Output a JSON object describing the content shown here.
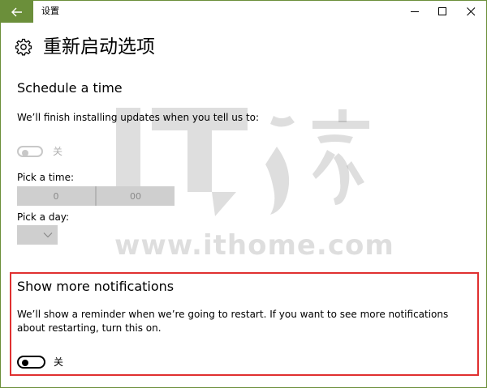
{
  "window": {
    "title": "设置"
  },
  "header": {
    "title": "重新启动选项"
  },
  "schedule": {
    "heading": "Schedule a time",
    "description": "We’ll finish installing updates when you tell us to:",
    "toggle_state_label": "关",
    "pick_time_label": "Pick a time:",
    "hour_value": "0",
    "minute_value": "00",
    "pick_day_label": "Pick a day:"
  },
  "notifications": {
    "heading": "Show more notifications",
    "description": "We’ll show a reminder when we’re going to restart. If you want to see more notifications about restarting, turn this on.",
    "toggle_state_label": "关"
  },
  "watermark": {
    "text": "www.ithome.com"
  },
  "colors": {
    "accent": "#6b8f3a",
    "highlight_border": "#e03030",
    "disabled": "#c8c8c8"
  }
}
